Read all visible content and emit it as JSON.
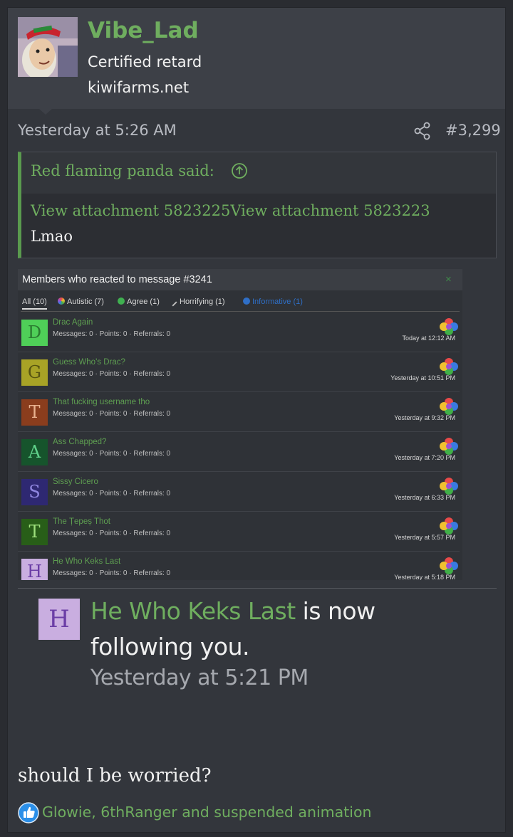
{
  "post": {
    "username": "Vibe_Lad",
    "user_title": "Certified retard",
    "user_banner": "kiwifarms.net",
    "date": "Yesterday at 5:26 AM",
    "post_number": "#3,299",
    "body": "should I be worried?"
  },
  "quote": {
    "author": "Red flaming panda said:",
    "links": [
      "View attachment 5823225",
      "View attachment 5823223"
    ],
    "text": "Lmao"
  },
  "reactions_dialog": {
    "title": "Members who reacted to message #3241",
    "close": "×",
    "tabs": [
      {
        "label": "All (10)"
      },
      {
        "label": "Autistic (7)"
      },
      {
        "label": "Agree (1)"
      },
      {
        "label": "Horrifying (1)"
      },
      {
        "label": "Informative (1)"
      }
    ],
    "members": [
      {
        "letter": "D",
        "name": "Drac Again",
        "meta": "Messages: 0 · Points: 0 · Referrals: 0",
        "time": "Today at 12:12 AM",
        "bg": "#4fcf58",
        "fg": "#2a7a30"
      },
      {
        "letter": "G",
        "name": "Guess Who's Drac?",
        "meta": "Messages: 0 · Points: 0 · Referrals: 0",
        "time": "Yesterday at 10:51 PM",
        "bg": "#a8a326",
        "fg": "#575411"
      },
      {
        "letter": "T",
        "name": "That fucking username tho",
        "meta": "Messages: 0 · Points: 0 · Referrals: 0",
        "time": "Yesterday at 9:32 PM",
        "bg": "#8a3d1d",
        "fg": "#e9b28f"
      },
      {
        "letter": "A",
        "name": "Ass Chapped?",
        "meta": "Messages: 0 · Points: 0 · Referrals: 0",
        "time": "Yesterday at 7:20 PM",
        "bg": "#16542c",
        "fg": "#5fd08a"
      },
      {
        "letter": "S",
        "name": "Sissy Cicero",
        "meta": "Messages: 0 · Points: 0 · Referrals: 0",
        "time": "Yesterday at 6:33 PM",
        "bg": "#2e2872",
        "fg": "#8f86e0"
      },
      {
        "letter": "T",
        "name": "The Țepeș Thot",
        "meta": "Messages: 0 · Points: 0 · Referrals: 0",
        "time": "Yesterday at 5:57 PM",
        "bg": "#285e18",
        "fg": "#9ee07c"
      },
      {
        "letter": "H",
        "name": "He Who Keks Last",
        "meta": "Messages: 0 · Points: 0 · Referrals: 0",
        "time": "Yesterday at 5:18 PM",
        "bg": "#c9aee0",
        "fg": "#6b3ea6"
      }
    ]
  },
  "follow_notice": {
    "avatar_letter": "H",
    "name": "He Who Keks Last",
    "line1_suffix": " is now",
    "line2": "following you.",
    "time": "Yesterday at 5:21 PM"
  },
  "reactions": {
    "text": "Glowie, 6thRanger and suspended animation"
  },
  "colors": {
    "accent_green": "#6fae5f",
    "background": "#33363c",
    "like_blue": "#2b8fe8"
  }
}
